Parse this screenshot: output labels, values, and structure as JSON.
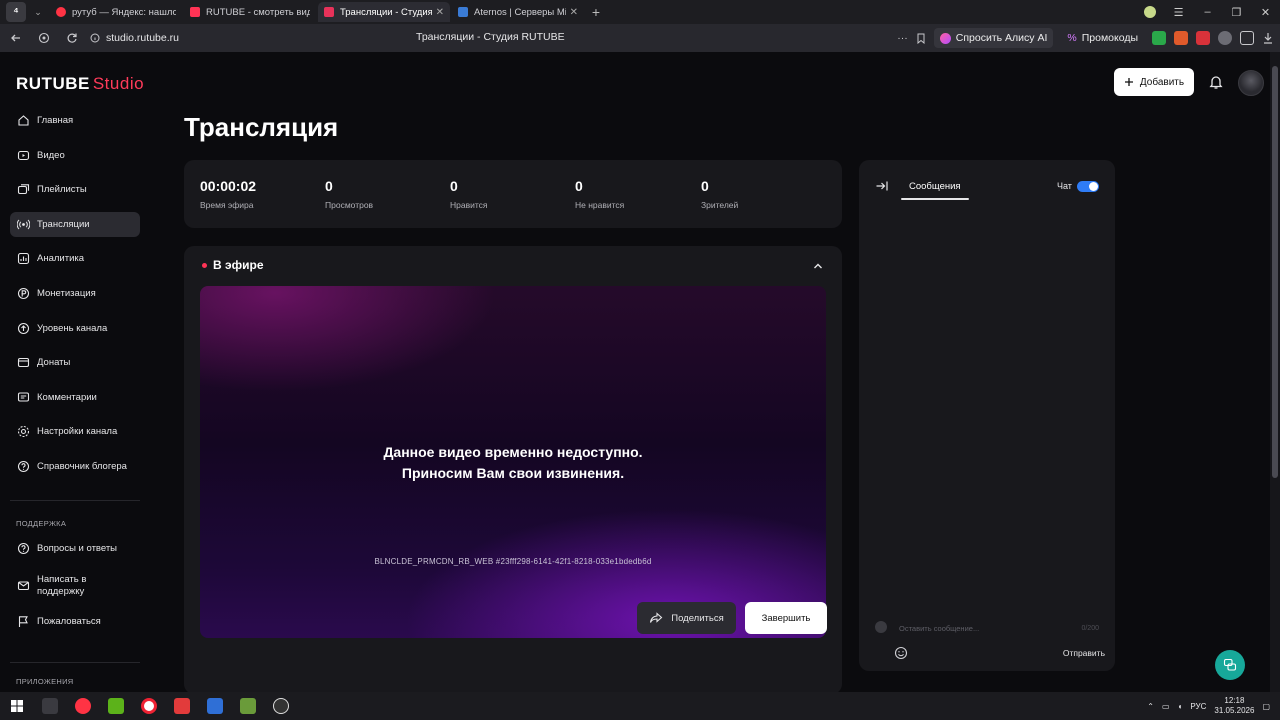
{
  "browser": {
    "tabs": [
      {
        "label": "рутуб — Яндекс: нашлось",
        "color": "#ff3344"
      },
      {
        "label": "RUTUBE - смотреть видео",
        "color": "#ff3355"
      },
      {
        "label": "Трансляции - Студия R",
        "color": "#e8325a"
      },
      {
        "label": "Aternos | Серверы Min",
        "color": "#3a7bd5"
      }
    ],
    "active_tab": 2,
    "url": "studio.rutube.ru",
    "page_title": "Трансляции - Студия RUTUBE",
    "alice_label": "Спросить Алису AI",
    "promo_label": "Промокоды"
  },
  "logo": {
    "part1": "RUTUBE",
    "part2": "Studio"
  },
  "sidebar": {
    "items": [
      {
        "label": "Главная",
        "icon": "home-icon"
      },
      {
        "label": "Видео",
        "icon": "video-icon"
      },
      {
        "label": "Плейлисты",
        "icon": "playlist-icon"
      },
      {
        "label": "Трансляции",
        "icon": "broadcast-icon"
      },
      {
        "label": "Аналитика",
        "icon": "analytics-icon"
      },
      {
        "label": "Монетизация",
        "icon": "monetization-icon"
      },
      {
        "label": "Уровень канала",
        "icon": "level-icon"
      },
      {
        "label": "Донаты",
        "icon": "donate-icon"
      },
      {
        "label": "Комментарии",
        "icon": "comments-icon"
      },
      {
        "label": "Настройки канала",
        "icon": "settings-icon"
      },
      {
        "label": "Справочник блогера",
        "icon": "guide-icon"
      }
    ],
    "active_index": 3,
    "support_section": "ПОДДЕРЖКА",
    "support_items": [
      {
        "label": "Вопросы и ответы",
        "icon": "faq-icon"
      },
      {
        "label": "Написать в поддержку",
        "icon": "mail-icon"
      },
      {
        "label": "Пожаловаться",
        "icon": "flag-icon"
      }
    ],
    "apps_section": "ПРИЛОЖЕНИЯ"
  },
  "header": {
    "add_label": "Добавить"
  },
  "page": {
    "title": "Трансляция"
  },
  "stats": [
    {
      "value": "00:00:02",
      "label": "Время эфира"
    },
    {
      "value": "0",
      "label": "Просмотров"
    },
    {
      "value": "0",
      "label": "Нравится"
    },
    {
      "value": "0",
      "label": "Не нравится"
    },
    {
      "value": "0",
      "label": "Зрителей"
    }
  ],
  "live": {
    "title": "В эфире",
    "message_line1": "Данное видео временно недоступно.",
    "message_line2": "Приносим Вам свои извинения.",
    "error_code": "BLNCLDE_PRMCDN_RB_WEB #23fff298-6141-42f1-8218-033e1bdedb6d",
    "share_label": "Поделиться",
    "end_label": "Завершить"
  },
  "chat": {
    "tab_label": "Сообщения",
    "toggle_label": "Чат",
    "toggle_on": true,
    "input_placeholder": "Оставить сообщение...",
    "counter": "0/200",
    "send_label": "Отправить"
  },
  "taskbar": {
    "lang": "РУС",
    "time": "12:18",
    "date": "31.05.2026"
  },
  "colors": {
    "brand_red": "#ff3b5a",
    "toggle_blue": "#2f7cf6",
    "support_teal": "#17a89a",
    "live_dot": "#ff3355"
  }
}
